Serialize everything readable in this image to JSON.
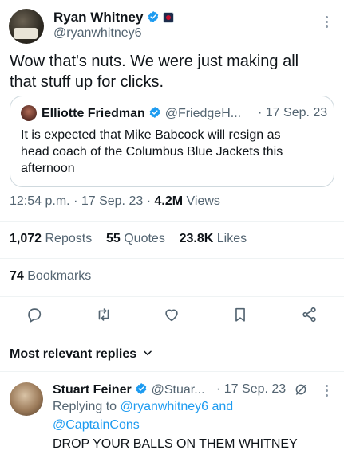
{
  "tweet": {
    "author_name": "Ryan Whitney",
    "author_handle": "@ryanwhitney6",
    "text_line1": "Wow that's nuts. We were just making all",
    "text_line2": "that stuff up for clicks.",
    "time": "12:54 p.m.",
    "date": "17 Sep. 23",
    "views_count": "4.2M",
    "views_label": "Views",
    "reposts_count": "1,072",
    "reposts_label": "Reposts",
    "quotes_count": "55",
    "quotes_label": "Quotes",
    "likes_count": "23.8K",
    "likes_label": "Likes",
    "bookmarks_count": "74",
    "bookmarks_label": "Bookmarks",
    "separator": "·"
  },
  "quote": {
    "author_name": "Elliotte Friedman",
    "author_handle": "@FriedgeH...",
    "date": "· 17 Sep. 23",
    "text_line1": "It is expected that Mike Babcock will resign as",
    "text_line2": "head coach of the Columbus Blue Jackets this",
    "text_line3": "afternoon"
  },
  "replies_sort": {
    "label": "Most relevant replies"
  },
  "reply": {
    "author_name": "Stuart Feiner",
    "author_handle": "@Stuar...",
    "date": "· 17 Sep. 23",
    "replying_to_label": "Replying to",
    "mention1": "@ryanwhitney6",
    "and_label": "and",
    "mention2": "@CaptainCons",
    "text": "DROP YOUR BALLS ON THEM WHITNEY"
  },
  "icons": {
    "verified": "verified-badge-icon",
    "affiliate": "affiliate-badge-icon",
    "more": "more-options-icon",
    "reply": "reply-icon",
    "repost": "repost-icon",
    "like": "like-icon",
    "bookmark": "bookmark-icon",
    "share": "share-icon",
    "chevron": "chevron-down-icon",
    "grok": "grok-icon"
  },
  "colors": {
    "accent": "#1d9bf0",
    "text": "#0f1419",
    "muted": "#536471",
    "border": "#cfd9de"
  }
}
